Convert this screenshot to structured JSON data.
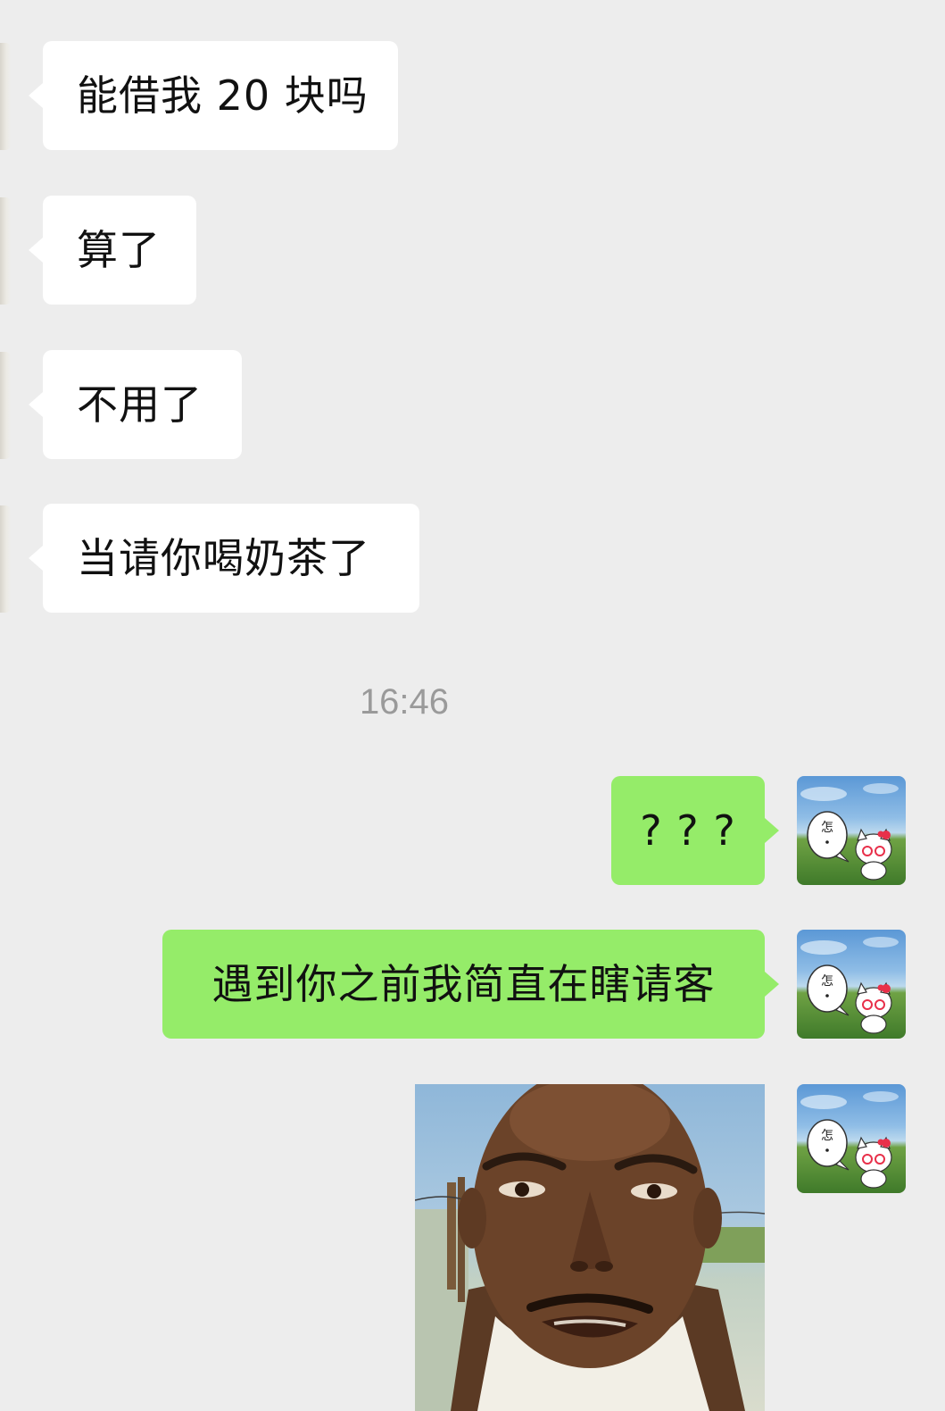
{
  "chat": {
    "incoming": [
      {
        "text": "能借我 20 块吗"
      },
      {
        "text": "算了"
      },
      {
        "text": "不用了"
      },
      {
        "text": "当请你喝奶茶了"
      }
    ],
    "timestamp": "16:46",
    "outgoing": [
      {
        "text": "? ? ?"
      },
      {
        "text": "遇到你之前我简直在瞎请客"
      }
    ],
    "avatar_bubble_char": "怎",
    "colors": {
      "background": "#ededed",
      "incoming_bubble": "#ffffff",
      "outgoing_bubble": "#95ec69",
      "timestamp_text": "#9a9a9a"
    }
  }
}
